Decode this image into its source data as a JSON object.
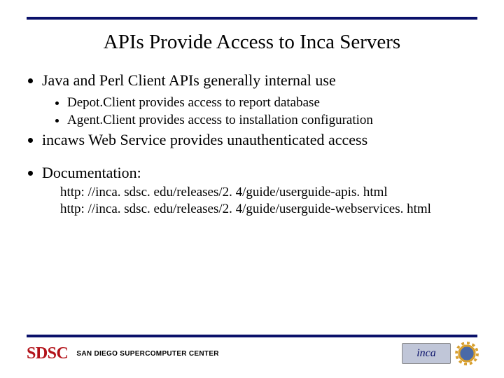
{
  "title": "APIs Provide Access to Inca Servers",
  "bullets": {
    "b0": "Java and Perl Client APIs generally internal use",
    "b0_sub": {
      "s0": "Depot.Client provides access to report database",
      "s1": "Agent.Client provides access to installation configuration"
    },
    "b1": "incaws Web Service provides unauthenticated access",
    "b2": "Documentation:",
    "b2_links": {
      "l0": "http: //inca. sdsc. edu/releases/2. 4/guide/userguide-apis. html",
      "l1": "http: //inca. sdsc. edu/releases/2. 4/guide/userguide-webservices. html"
    }
  },
  "footer": {
    "sdsc": "SDSC",
    "center_text": "SAN DIEGO SUPERCOMPUTER CENTER",
    "inca": "inca"
  }
}
